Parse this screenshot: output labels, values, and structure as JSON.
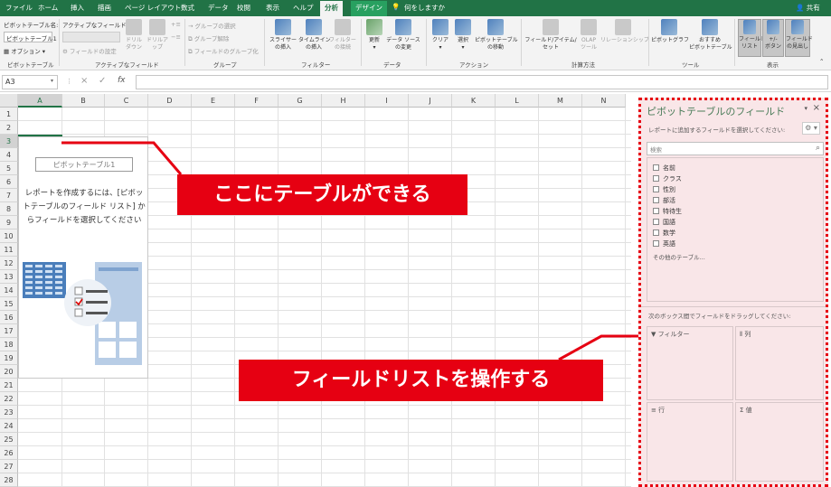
{
  "ribbon_tabs": [
    "ファイル",
    "ホーム",
    "挿入",
    "描画",
    "ページ レイアウト",
    "数式",
    "データ",
    "校閲",
    "表示",
    "ヘルプ",
    "分析",
    "デザイン"
  ],
  "tell_me": "何をしますか",
  "share": "共有",
  "ribbon": {
    "pivot_name_label": "ピボットテーブル名:",
    "pivot_name_value": "ピボットテーブル1",
    "options_label": "オプション",
    "group_pivottable": "ピボットテーブル",
    "active_field_label": "アクティブなフィールド:",
    "field_settings": "フィールドの設定",
    "drill_down": "ドリル\nダウン",
    "drill_up": "ドリルア\nップ",
    "group_active_field": "アクティブなフィールド",
    "group_selection": "グループの選択",
    "ungroup": "グループ解除",
    "group_field": "フィールドのグループ化",
    "group_group": "グループ",
    "insert_slicer": "スライサー\nの挿入",
    "insert_timeline": "タイムライン\nの挿入",
    "filter_connections": "フィルター\nの接続",
    "group_filter": "フィルター",
    "refresh": "更新",
    "change_source": "データ ソース\nの変更",
    "group_data": "データ",
    "clear": "クリア",
    "select": "選択",
    "move_pivot": "ピボットテーブル\nの移動",
    "group_action": "アクション",
    "fields_items_sets": "フィールド/アイテム/\nセット",
    "olap_tools": "OLAP\nツール",
    "relationships": "リレーションシップ",
    "group_calc": "計算方法",
    "pivot_chart": "ピボットグラフ",
    "recommended_pivot": "おすすめ\nピボットテーブル",
    "group_tools": "ツール",
    "field_list_btn": "フィールド\nリスト",
    "plus_minus_btn": "+/-\nボタン",
    "field_headers_btn": "フィールド\nの見出し",
    "group_show": "表示"
  },
  "formula_bar": {
    "name_box": "A3",
    "cancel": "×",
    "enter": "✓",
    "fx": "fx",
    "content": ""
  },
  "columns": [
    "A",
    "B",
    "C",
    "D",
    "E",
    "F",
    "G",
    "H",
    "I",
    "J",
    "K",
    "L",
    "M",
    "N"
  ],
  "rows": [
    "1",
    "2",
    "3",
    "4",
    "5",
    "6",
    "7",
    "8",
    "9",
    "10",
    "11",
    "12",
    "13",
    "14",
    "15",
    "16",
    "17",
    "18",
    "19",
    "20",
    "21",
    "22",
    "23",
    "24",
    "25",
    "26",
    "27",
    "28"
  ],
  "pivot_placeholder": {
    "name": "ピボットテーブル1",
    "message": "レポートを作成するには、[ピボットテーブルのフィールド リスト] からフィールドを選択してください"
  },
  "field_pane": {
    "title": "ピボットテーブルのフィールド",
    "close": "×",
    "dropdown": "▾",
    "subtitle": "レポートに追加するフィールドを選択してください:",
    "settings": "⚙ ▾",
    "search_placeholder": "検索",
    "fields": [
      "名前",
      "クラス",
      "性別",
      "部活",
      "特待生",
      "国語",
      "数学",
      "英語"
    ],
    "other_tables": "その他のテーブル...",
    "drag_label": "次のボックス間でフィールドをドラッグしてください:",
    "areas": {
      "filter": "フィルター",
      "columns": "列",
      "rows": "行",
      "values": "値"
    }
  },
  "callouts": {
    "table_here": "ここにテーブルができる",
    "operate_fields": "フィールドリストを操作する"
  },
  "colors": {
    "excel_green": "#217346",
    "callout_red": "#e60012",
    "pane_bg": "#f9e6e8"
  }
}
